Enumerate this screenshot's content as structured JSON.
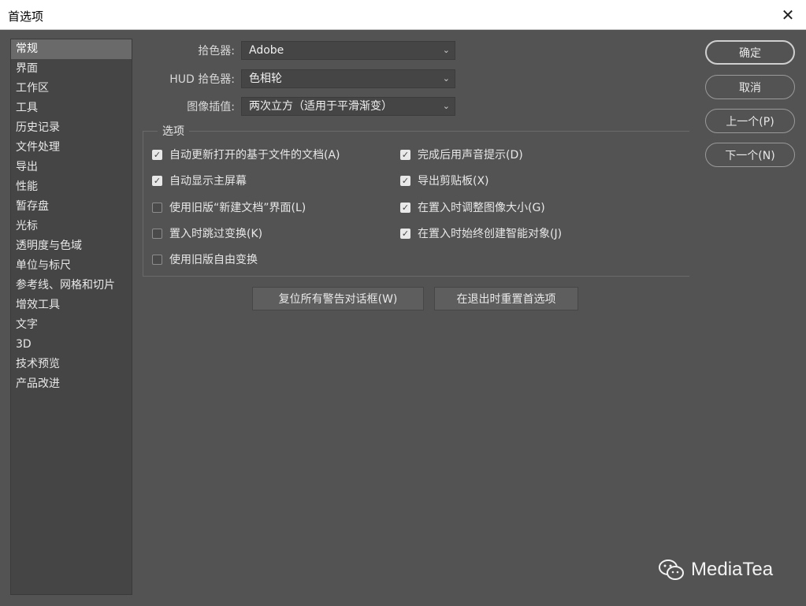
{
  "window": {
    "title": "首选项"
  },
  "sidebar": {
    "items": [
      {
        "label": "常规"
      },
      {
        "label": "界面"
      },
      {
        "label": "工作区"
      },
      {
        "label": "工具"
      },
      {
        "label": "历史记录"
      },
      {
        "label": "文件处理"
      },
      {
        "label": "导出"
      },
      {
        "label": "性能"
      },
      {
        "label": "暂存盘"
      },
      {
        "label": "光标"
      },
      {
        "label": "透明度与色域"
      },
      {
        "label": "单位与标尺"
      },
      {
        "label": "参考线、网格和切片"
      },
      {
        "label": "增效工具"
      },
      {
        "label": "文字"
      },
      {
        "label": "3D"
      },
      {
        "label": "技术预览"
      },
      {
        "label": "产品改进"
      }
    ],
    "selected": "常规"
  },
  "settings": {
    "color_picker": {
      "label": "拾色器:",
      "value": "Adobe"
    },
    "hud_color_picker": {
      "label": "HUD 拾色器:",
      "value": "色相轮"
    },
    "image_interpolation": {
      "label": "图像插值:",
      "value": "两次立方（适用于平滑渐变）"
    }
  },
  "options": {
    "title": "选项",
    "left": [
      {
        "label": "自动更新打开的基于文件的文档(A)",
        "checked": true
      },
      {
        "label": "自动显示主屏幕",
        "checked": true
      },
      {
        "label": "使用旧版“新建文档”界面(L)",
        "checked": false
      },
      {
        "label": "置入时跳过变换(K)",
        "checked": false
      },
      {
        "label": "使用旧版自由变换",
        "checked": false
      }
    ],
    "right": [
      {
        "label": "完成后用声音提示(D)",
        "checked": true
      },
      {
        "label": "导出剪贴板(X)",
        "checked": true
      },
      {
        "label": "在置入时调整图像大小(G)",
        "checked": true
      },
      {
        "label": "在置入时始终创建智能对象(J)",
        "checked": true
      }
    ]
  },
  "buttons": {
    "reset_warnings": "复位所有警告对话框(W)",
    "reset_on_quit": "在退出时重置首选项",
    "ok": "确定",
    "cancel": "取消",
    "prev": "上一个(P)",
    "next": "下一个(N)"
  },
  "watermark": {
    "text": "MediaTea",
    "icon": "wechat-icon"
  }
}
